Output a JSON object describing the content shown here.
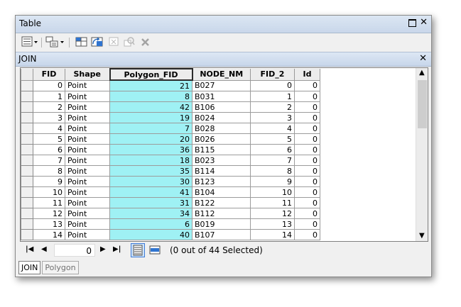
{
  "window": {
    "title": "Table"
  },
  "table_tab": {
    "name": "JOIN"
  },
  "columns": [
    "FID",
    "Shape",
    "Polygon_FID",
    "NODE_NM",
    "FID_2",
    "Id"
  ],
  "rows": [
    {
      "fid": "0",
      "shape": "Point",
      "polygon_fid": "21",
      "node_nm": "B027",
      "fid_2": "0",
      "id": "0"
    },
    {
      "fid": "1",
      "shape": "Point",
      "polygon_fid": "8",
      "node_nm": "B031",
      "fid_2": "1",
      "id": "0"
    },
    {
      "fid": "2",
      "shape": "Point",
      "polygon_fid": "42",
      "node_nm": "B106",
      "fid_2": "2",
      "id": "0"
    },
    {
      "fid": "3",
      "shape": "Point",
      "polygon_fid": "19",
      "node_nm": "B024",
      "fid_2": "3",
      "id": "0"
    },
    {
      "fid": "4",
      "shape": "Point",
      "polygon_fid": "7",
      "node_nm": "B028",
      "fid_2": "4",
      "id": "0"
    },
    {
      "fid": "5",
      "shape": "Point",
      "polygon_fid": "20",
      "node_nm": "B026",
      "fid_2": "5",
      "id": "0"
    },
    {
      "fid": "6",
      "shape": "Point",
      "polygon_fid": "36",
      "node_nm": "B115",
      "fid_2": "6",
      "id": "0"
    },
    {
      "fid": "7",
      "shape": "Point",
      "polygon_fid": "18",
      "node_nm": "B023",
      "fid_2": "7",
      "id": "0"
    },
    {
      "fid": "8",
      "shape": "Point",
      "polygon_fid": "35",
      "node_nm": "B114",
      "fid_2": "8",
      "id": "0"
    },
    {
      "fid": "9",
      "shape": "Point",
      "polygon_fid": "30",
      "node_nm": "B123",
      "fid_2": "9",
      "id": "0"
    },
    {
      "fid": "10",
      "shape": "Point",
      "polygon_fid": "41",
      "node_nm": "B104",
      "fid_2": "10",
      "id": "0"
    },
    {
      "fid": "11",
      "shape": "Point",
      "polygon_fid": "31",
      "node_nm": "B122",
      "fid_2": "11",
      "id": "0"
    },
    {
      "fid": "12",
      "shape": "Point",
      "polygon_fid": "34",
      "node_nm": "B112",
      "fid_2": "12",
      "id": "0"
    },
    {
      "fid": "13",
      "shape": "Point",
      "polygon_fid": "6",
      "node_nm": "B019",
      "fid_2": "13",
      "id": "0"
    },
    {
      "fid": "14",
      "shape": "Point",
      "polygon_fid": "40",
      "node_nm": "B107",
      "fid_2": "14",
      "id": "0"
    }
  ],
  "selected_column": "Polygon_FID",
  "navigation": {
    "record": "0",
    "status": "(0 out of 44 Selected)"
  },
  "bottom_tabs": [
    "JOIN",
    "Polygon"
  ],
  "icons": {
    "toolbar": [
      "table-options-icon",
      "related-tables-icon",
      "select-by-attributes-icon",
      "switch-selection-icon",
      "clear-selection-icon",
      "zoom-to-selected-icon",
      "delete-selected-icon"
    ],
    "navigation": [
      "first-record-icon",
      "previous-record-icon",
      "next-record-icon",
      "last-record-icon",
      "show-all-records-icon",
      "show-selected-records-icon"
    ]
  },
  "colors": {
    "title_bar": "#c9d7ea",
    "selected_column": "#9ff1f4",
    "view_active": "#cfe4fb"
  }
}
